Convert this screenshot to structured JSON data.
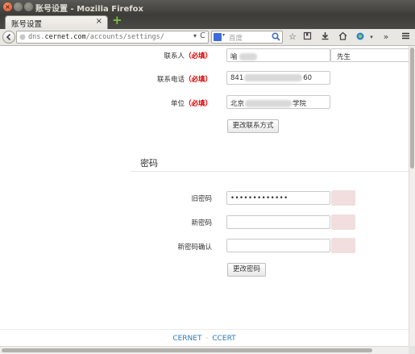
{
  "window": {
    "title": "账号设置 - Mozilla Firefox"
  },
  "tab": {
    "label": "账号设置",
    "close": "×",
    "new_tab": "+"
  },
  "navbar": {
    "url_host": "dns.",
    "url_domain": "cernet.com",
    "url_path": "/accounts/settings/",
    "url_dropdown": "▾",
    "reload": "C",
    "search_placeholder": "百度",
    "search_engine_dropdown": "▾"
  },
  "contact": {
    "name_label": "联系人",
    "required_mark": "（必填）",
    "name_value": "喻",
    "title_value": "先生",
    "phone_label": "联系电话",
    "phone_value_start": "841",
    "phone_value_end": "60",
    "org_label": "单位",
    "org_value_start": "北京",
    "org_value_end": "学院",
    "submit_label": "更改联系方式"
  },
  "password": {
    "section_title": "密码",
    "old_label": "旧密码",
    "old_value": "•••••••••••••",
    "new_label": "新密码",
    "new_value": "",
    "confirm_label": "新密码确认",
    "confirm_value": "",
    "submit_label": "更改密码"
  },
  "footer": {
    "link1": "CERNET",
    "separator": "·",
    "link2": "CCERT"
  }
}
